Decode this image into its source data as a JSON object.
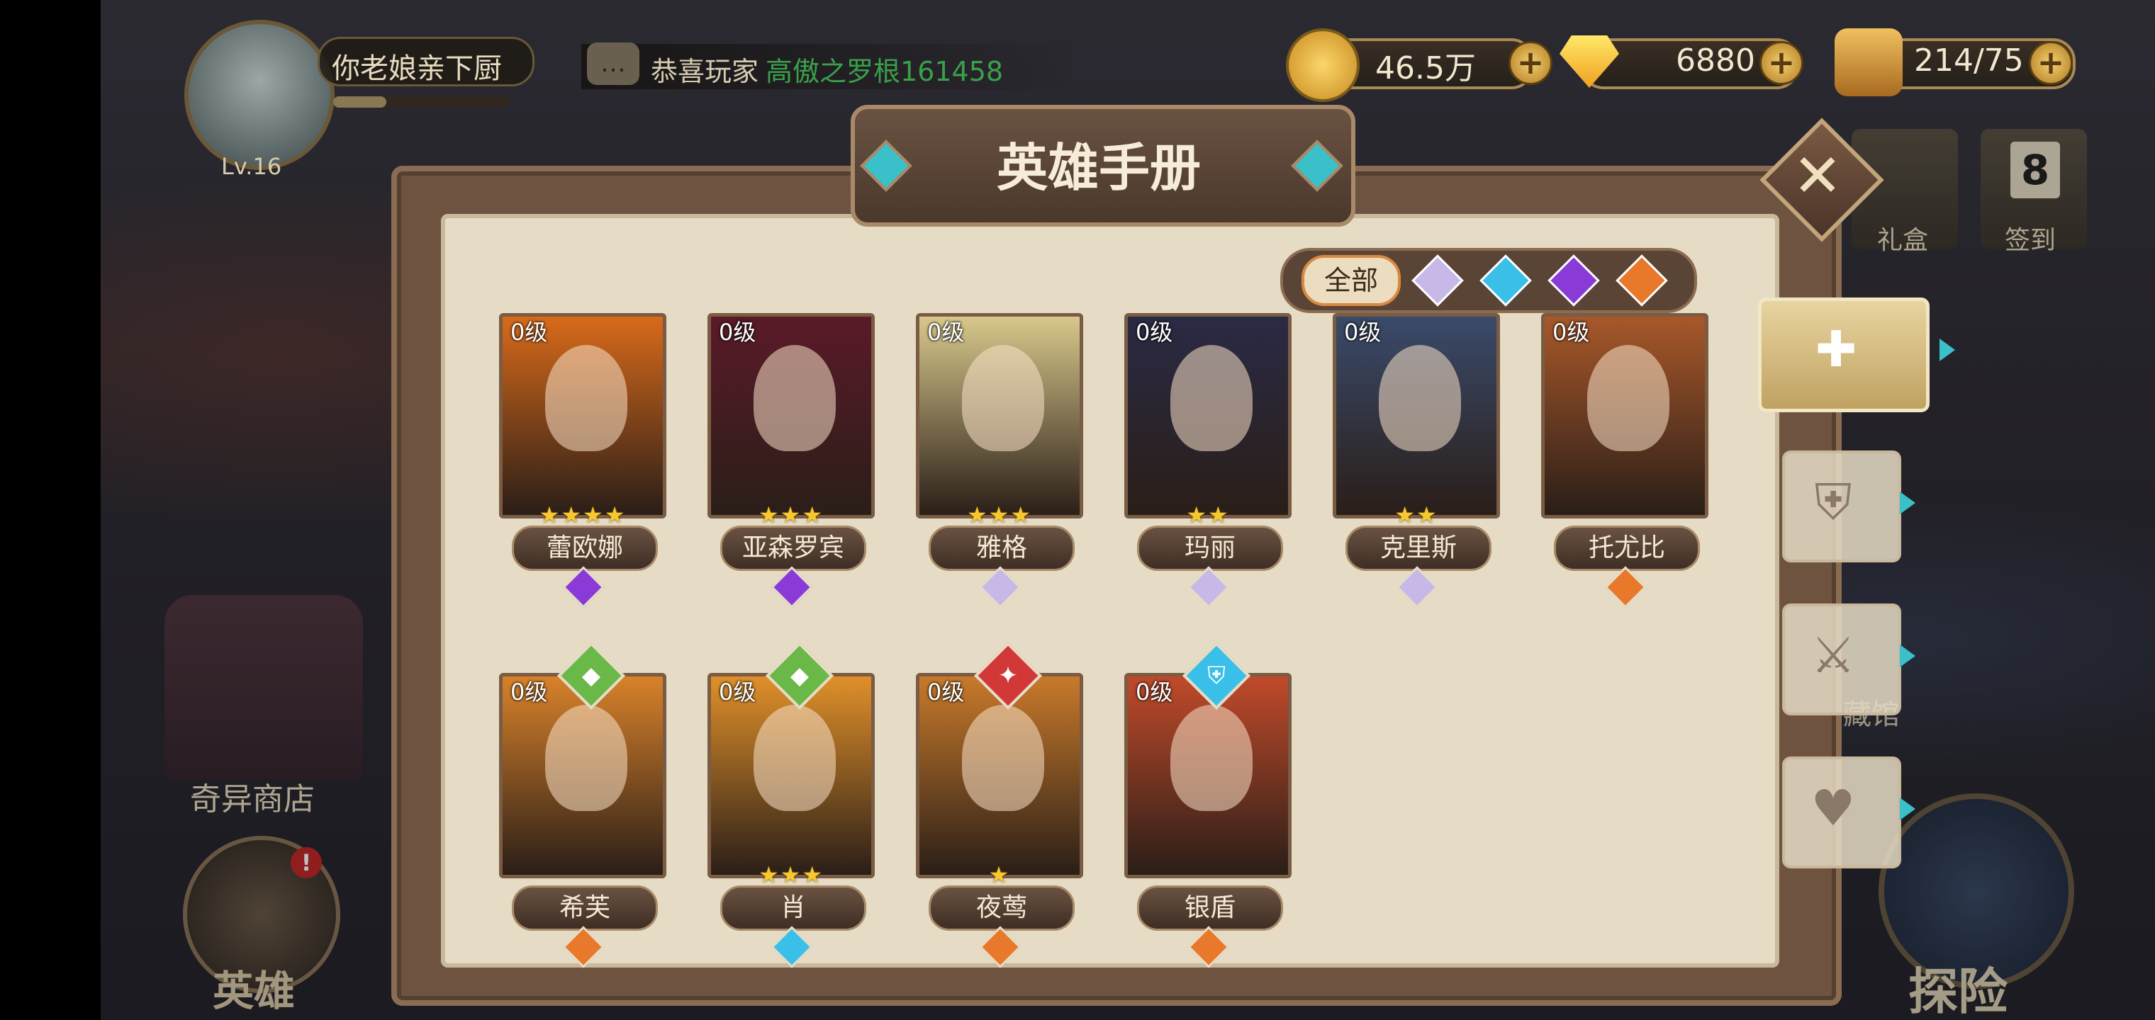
{
  "player": {
    "name": "你老娘亲下厨",
    "level": "Lv.16"
  },
  "ticker": {
    "prefix": "恭喜玩家",
    "highlight": "高傲之罗根161458"
  },
  "resources": {
    "gold": "46.5万",
    "diamonds": "6880",
    "stamina": "214/75"
  },
  "panel": {
    "title": "英雄手册",
    "filter_all": "全部"
  },
  "background": {
    "shop": "奇异商店",
    "hero": "英雄",
    "explore": "探险",
    "museum": "藏馆",
    "gift": "礼盒",
    "signin": "签到",
    "signin_day": "8",
    "hero_badge": "!"
  },
  "colors": {
    "purple": "#8a3ad6",
    "white": "#c8b8e8",
    "orange": "#e8782a",
    "cyan": "#3ac0e8",
    "green": "#6ab848",
    "red": "#d23838",
    "star": "#f6c830"
  },
  "heroes": [
    {
      "level": "0级",
      "name": "蕾欧娜",
      "stars": "★★★★",
      "rank": "purple",
      "bg": "#d86a1a",
      "role": ""
    },
    {
      "level": "0级",
      "name": "亚森罗宾",
      "stars": "★★★",
      "rank": "purple",
      "bg": "#5a1a28",
      "role": ""
    },
    {
      "level": "0级",
      "name": "雅格",
      "stars": "★★★",
      "rank": "white",
      "bg": "#d8c88c",
      "role": ""
    },
    {
      "level": "0级",
      "name": "玛丽",
      "stars": "★★",
      "rank": "white",
      "bg": "#2a2a44",
      "role": ""
    },
    {
      "level": "0级",
      "name": "克里斯",
      "stars": "★★",
      "rank": "white",
      "bg": "#3a4a6a",
      "role": ""
    },
    {
      "level": "0级",
      "name": "托尤比",
      "stars": "",
      "rank": "orange",
      "bg": "#a8582a",
      "role": ""
    },
    {
      "level": "0级",
      "name": "希芙",
      "stars": "",
      "rank": "orange",
      "bg": "#d8822a",
      "role": "green"
    },
    {
      "level": "0级",
      "name": "肖",
      "stars": "★★★",
      "rank": "cyan",
      "bg": "#e0902a",
      "role": "green"
    },
    {
      "level": "0级",
      "name": "夜莺",
      "stars": "★",
      "rank": "orange",
      "bg": "#c87a2a",
      "role": "red"
    },
    {
      "level": "0级",
      "name": "银盾",
      "stars": "",
      "rank": "orange",
      "bg": "#c04a2a",
      "role": "cyan"
    }
  ]
}
